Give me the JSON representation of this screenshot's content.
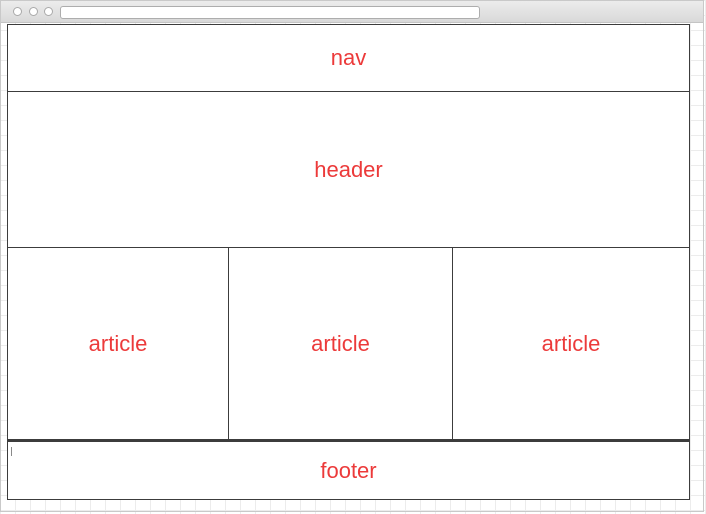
{
  "browser": {
    "address_value": ""
  },
  "layout_blocks": {
    "nav_label": "nav",
    "header_label": "header",
    "articles": [
      {
        "label": "article"
      },
      {
        "label": "article"
      },
      {
        "label": "article"
      }
    ],
    "footer_label": "footer"
  },
  "colors": {
    "label_text": "#ec3a3a",
    "block_border": "#3c3c3c",
    "chrome_bg": "#e3e3e3"
  }
}
